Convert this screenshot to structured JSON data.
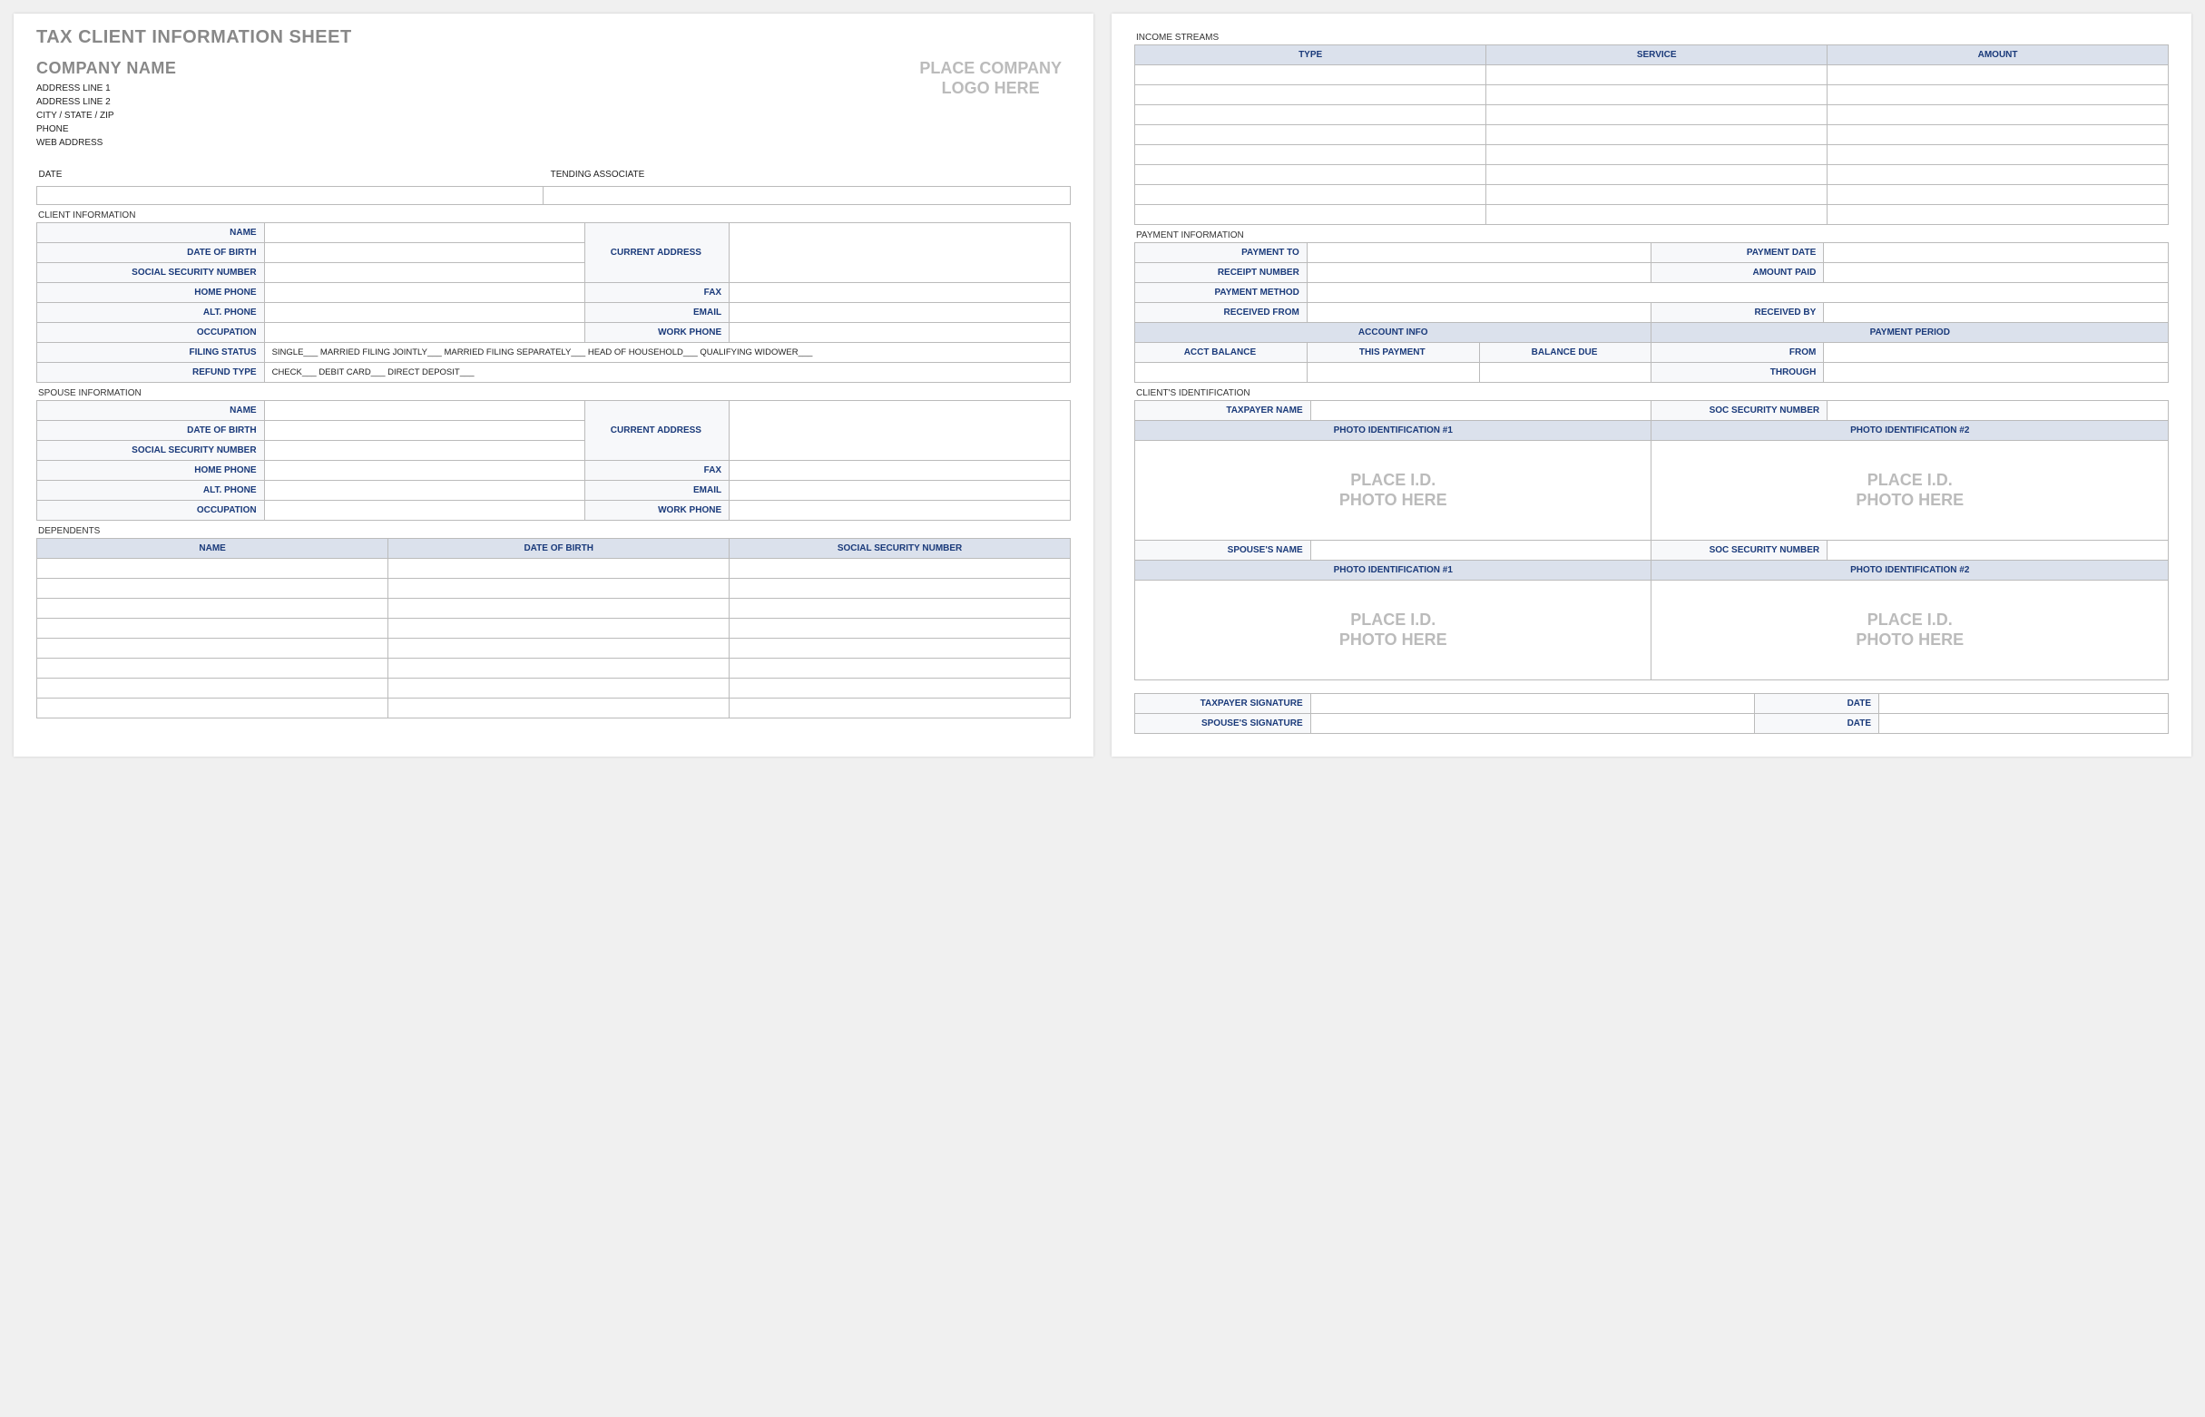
{
  "title": "TAX CLIENT INFORMATION SHEET",
  "company": {
    "name": "COMPANY NAME",
    "addr1": "ADDRESS LINE 1",
    "addr2": "ADDRESS LINE 2",
    "csz": "CITY / STATE / ZIP",
    "phone": "PHONE",
    "web": "WEB ADDRESS"
  },
  "logo_placeholder": "PLACE COMPANY\nLOGO HERE",
  "top": {
    "date": "DATE",
    "associate": "TENDING ASSOCIATE"
  },
  "sections": {
    "client": "CLIENT INFORMATION",
    "spouse": "SPOUSE INFORMATION",
    "dependents": "DEPENDENTS",
    "income": "INCOME STREAMS",
    "payment": "PAYMENT INFORMATION",
    "id": "CLIENT'S IDENTIFICATION"
  },
  "client": {
    "name": "NAME",
    "dob": "DATE OF BIRTH",
    "ssn": "SOCIAL SECURITY NUMBER",
    "home": "HOME PHONE",
    "alt": "ALT. PHONE",
    "occ": "OCCUPATION",
    "filing": "FILING STATUS",
    "refund": "REFUND TYPE",
    "curaddr": "CURRENT ADDRESS",
    "fax": "FAX",
    "email": "EMAIL",
    "work": "WORK PHONE",
    "filing_opts": "SINGLE___   MARRIED FILING JOINTLY___   MARRIED FILING SEPARATELY___   HEAD OF HOUSEHOLD___   QUALIFYING WIDOWER___",
    "refund_opts": "CHECK___    DEBIT CARD___    DIRECT DEPOSIT___"
  },
  "dependents_hdr": {
    "name": "NAME",
    "dob": "DATE OF BIRTH",
    "ssn": "SOCIAL SECURITY NUMBER"
  },
  "income_hdr": {
    "type": "TYPE",
    "service": "SERVICE",
    "amount": "AMOUNT"
  },
  "payment": {
    "to": "PAYMENT TO",
    "date": "PAYMENT DATE",
    "receipt": "RECEIPT NUMBER",
    "paid": "AMOUNT PAID",
    "method": "PAYMENT METHOD",
    "from": "RECEIVED FROM",
    "by": "RECEIVED BY",
    "acctinfo": "ACCOUNT INFO",
    "period": "PAYMENT PERIOD",
    "bal": "ACCT BALANCE",
    "thispay": "THIS PAYMENT",
    "due": "BALANCE DUE",
    "pfrom": "FROM",
    "pthru": "THROUGH"
  },
  "id": {
    "taxpayer": "TAXPAYER NAME",
    "spouse": "SPOUSE'S NAME",
    "ssn": "SOC SECURITY NUMBER",
    "photo1": "PHOTO IDENTIFICATION #1",
    "photo2": "PHOTO IDENTIFICATION #2",
    "placeholder": "PLACE I.D.\nPHOTO HERE"
  },
  "sig": {
    "taxpayer": "TAXPAYER SIGNATURE",
    "spouse": "SPOUSE'S SIGNATURE",
    "date": "DATE"
  }
}
